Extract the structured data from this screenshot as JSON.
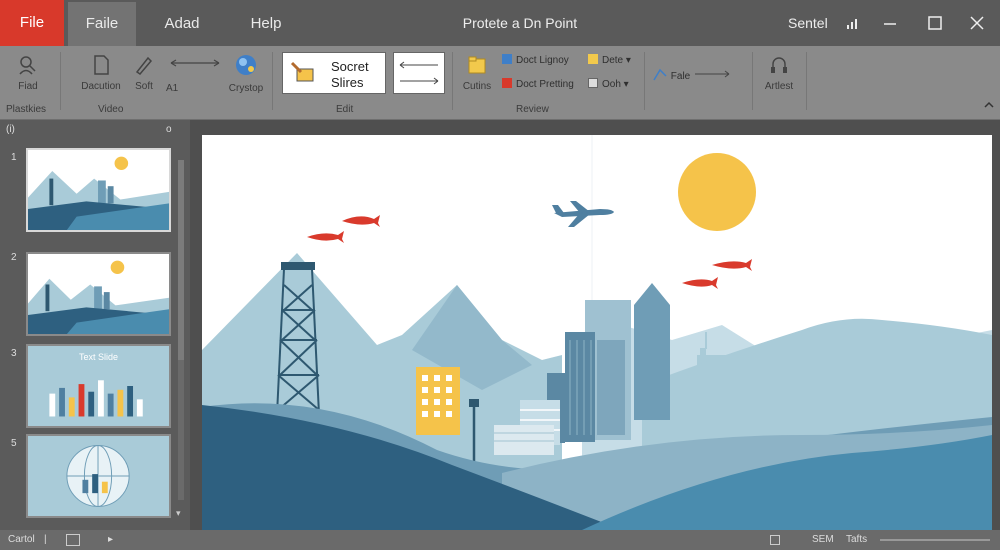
{
  "window": {
    "title": "Protete a Dn Point",
    "user": "Sentel"
  },
  "menu": {
    "file": "File",
    "home": "Faile",
    "insert": "Adad",
    "help": "Help"
  },
  "ribbon": {
    "find": "Fiad",
    "duration": "Dacution",
    "soft": "Soft",
    "arrow_text": "A1",
    "crystop": "Crystop",
    "sample_text": "Socret",
    "sample_text_2": "Slires",
    "cutins": "Cutins",
    "check_1": "Doct Lignoy",
    "check_2": "Doct Pretting",
    "check_3": "Dete",
    "check_4": "Ooh",
    "fale": "Fale",
    "artlest": "Artlest",
    "group_plasties": "Plastkies",
    "group_video": "Video",
    "group_edit": "Edit",
    "group_review": "Review"
  },
  "panel": {
    "top_left": "(i)",
    "top_right": "o",
    "slides": [
      {
        "num": "1",
        "title": ""
      },
      {
        "num": "2",
        "title": ""
      },
      {
        "num": "3",
        "title": "Text Slide"
      },
      {
        "num": "5",
        "title": ""
      }
    ]
  },
  "status": {
    "left": "Cartol",
    "right1": "SEM",
    "right2": "Tafts"
  },
  "colors": {
    "file_tab": "#d8392b",
    "sun": "#f5c34a",
    "sky_blue": "#a9cbd8",
    "deep_blue": "#2e6080",
    "accent_red": "#d93a2c"
  },
  "icons": {
    "find": "person-search-icon",
    "duration": "document-icon",
    "soft": "pen-icon",
    "crystop": "globe-icon",
    "cutins": "folder-icon",
    "artlest": "headset-icon"
  }
}
